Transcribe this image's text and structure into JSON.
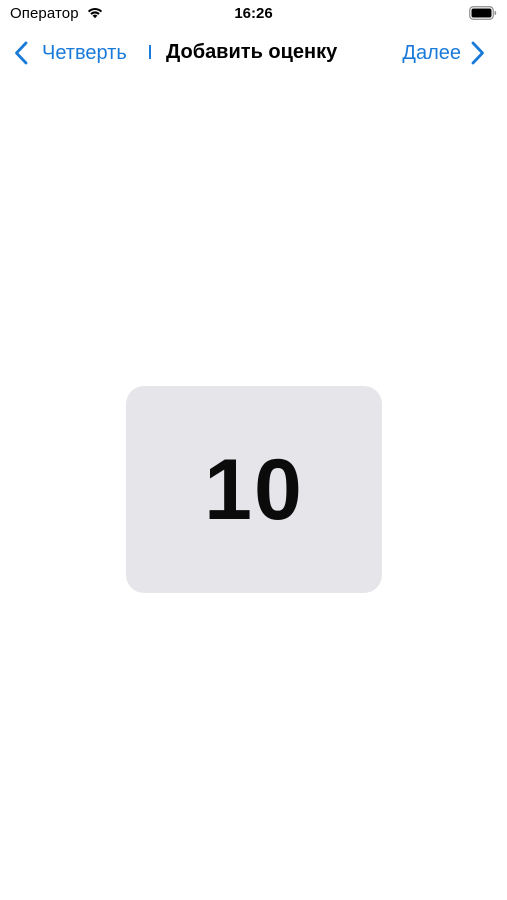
{
  "status_bar": {
    "carrier": "Оператор",
    "time": "16:26",
    "icons": [
      "wifi-icon",
      "battery-icon"
    ]
  },
  "nav_bar": {
    "back_label": "Четверть",
    "title": "Добавить оценку",
    "next_label": "Далее",
    "icons": [
      "chevron-left-icon",
      "chevron-right-icon"
    ],
    "accent_color": "#1a7ad9"
  },
  "grade_card": {
    "value": "10",
    "background_color": "#e6e5ea"
  }
}
